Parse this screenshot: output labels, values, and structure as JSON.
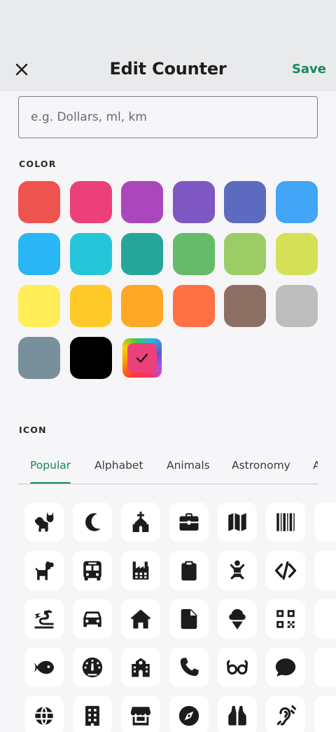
{
  "header": {
    "title": "Edit Counter",
    "save_label": "Save",
    "close_icon": "close-icon"
  },
  "unit_field": {
    "value": "",
    "placeholder": "e.g. Dollars, ml, km"
  },
  "color_section": {
    "label": "COLOR",
    "selected": "custom-rainbow",
    "swatches": [
      {
        "name": "red",
        "hex": "#ef5350"
      },
      {
        "name": "pink",
        "hex": "#ec407a"
      },
      {
        "name": "purple",
        "hex": "#ab47bc"
      },
      {
        "name": "deep-purple",
        "hex": "#7e57c2"
      },
      {
        "name": "indigo",
        "hex": "#5c6bc0"
      },
      {
        "name": "blue",
        "hex": "#42a5f5"
      },
      {
        "name": "light-blue",
        "hex": "#29b6f6"
      },
      {
        "name": "cyan",
        "hex": "#26c6da"
      },
      {
        "name": "teal",
        "hex": "#26a69a"
      },
      {
        "name": "green",
        "hex": "#66bb6a"
      },
      {
        "name": "light-green",
        "hex": "#9ccc65"
      },
      {
        "name": "lime",
        "hex": "#d4e157"
      },
      {
        "name": "yellow",
        "hex": "#ffee58"
      },
      {
        "name": "amber",
        "hex": "#ffca28"
      },
      {
        "name": "orange",
        "hex": "#ffa726"
      },
      {
        "name": "deep-orange",
        "hex": "#ff7043"
      },
      {
        "name": "brown",
        "hex": "#8d6e63"
      },
      {
        "name": "grey",
        "hex": "#bdbdbd"
      },
      {
        "name": "blue-grey",
        "hex": "#78909c"
      },
      {
        "name": "black",
        "hex": "#000000"
      },
      {
        "name": "custom-rainbow",
        "hex": "#ec407a",
        "checked": true
      }
    ]
  },
  "icon_section": {
    "label": "ICON",
    "tabs": [
      {
        "label": "Popular",
        "active": true
      },
      {
        "label": "Alphabet"
      },
      {
        "label": "Animals"
      },
      {
        "label": "Astronomy"
      },
      {
        "label": "A"
      }
    ],
    "icons": [
      [
        "cat-icon",
        "moon-icon",
        "church-icon",
        "briefcase-icon",
        "map-icon",
        "barcode-icon"
      ],
      [
        "dog-icon",
        "bus-icon",
        "factory-icon",
        "clipboard-icon",
        "baby-icon",
        "code-icon"
      ],
      [
        "dragon-icon",
        "car-icon",
        "house-icon",
        "file-icon",
        "ice-cream-icon",
        "qr-code-icon"
      ],
      [
        "fish-icon",
        "gauge-icon",
        "school-icon",
        "phone-icon",
        "glasses-icon",
        "chat-bubble-icon"
      ],
      [
        "globe-icon",
        "building-icon",
        "shop-icon",
        "compass-icon",
        "vest-icon",
        "ear-icon"
      ]
    ]
  },
  "colors": {
    "accent": "#138a5f",
    "header_bg": "#e9eaeb",
    "page_bg": "#f6f5f8"
  }
}
